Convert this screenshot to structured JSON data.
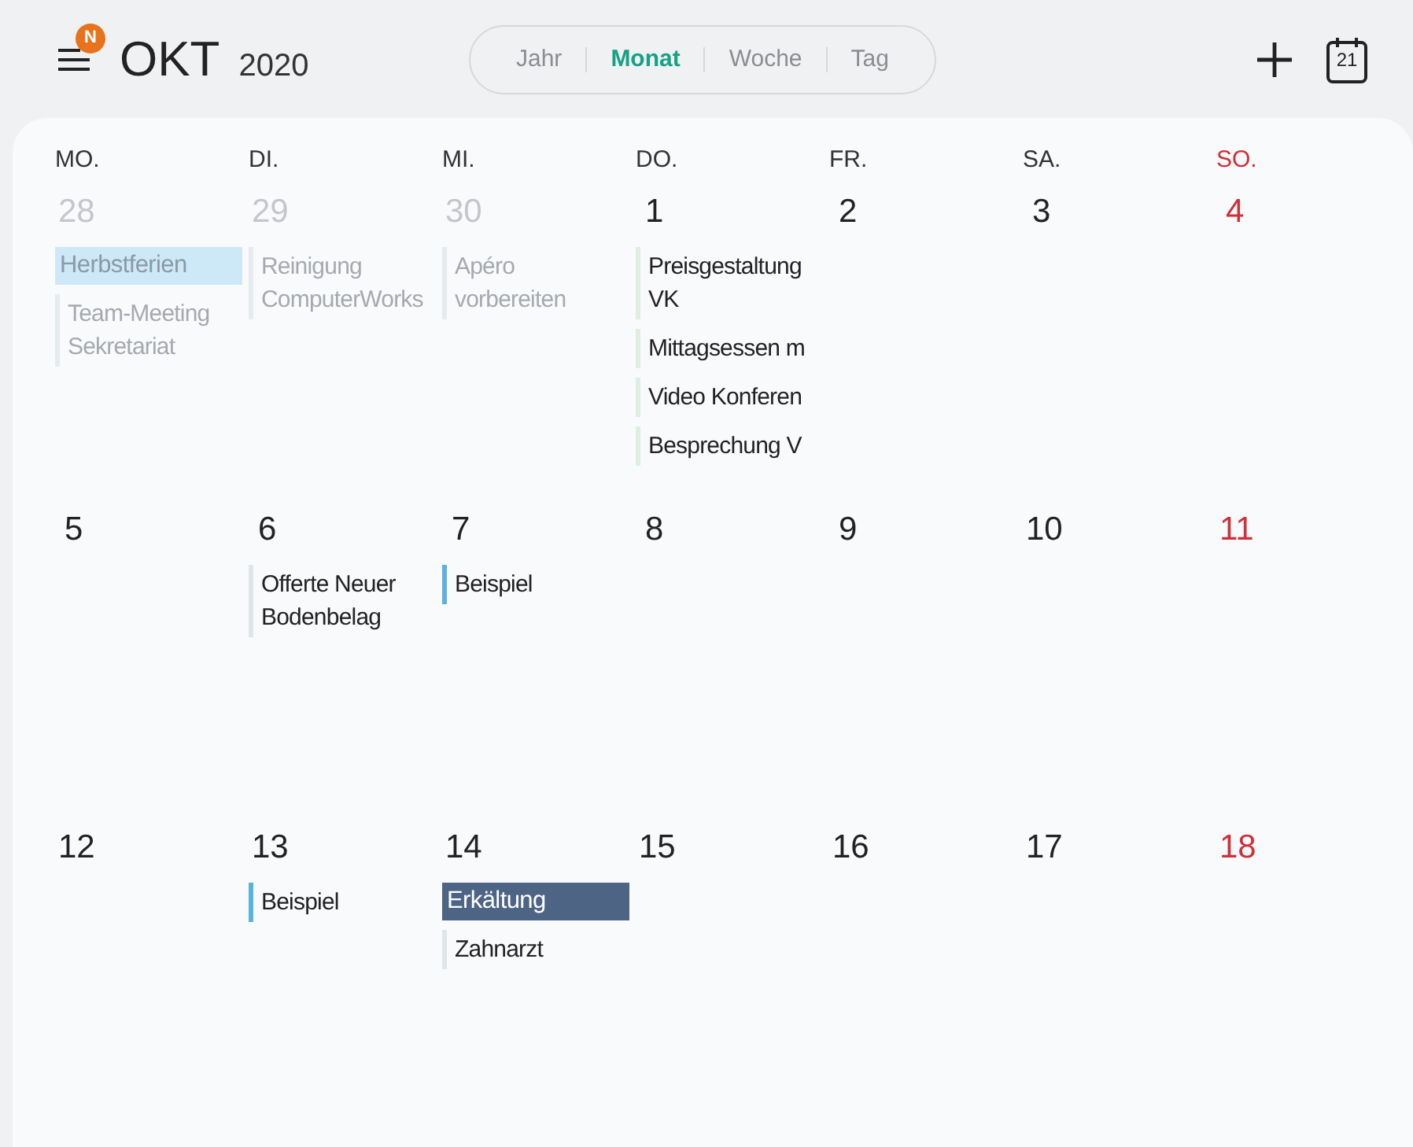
{
  "header": {
    "badge": "N",
    "month": "OKT",
    "year": "2020",
    "view_tabs": [
      {
        "label": "Jahr",
        "selected": false
      },
      {
        "label": "Monat",
        "selected": true
      },
      {
        "label": "Woche",
        "selected": false
      },
      {
        "label": "Tag",
        "selected": false
      }
    ],
    "today_icon": "21"
  },
  "weekdays": [
    {
      "label": "MO.",
      "kind": "weekday"
    },
    {
      "label": "DI.",
      "kind": "weekday"
    },
    {
      "label": "MI.",
      "kind": "weekday"
    },
    {
      "label": "DO.",
      "kind": "weekday"
    },
    {
      "label": "FR.",
      "kind": "weekday"
    },
    {
      "label": "SA.",
      "kind": "weekday"
    },
    {
      "label": "SO.",
      "kind": "sunday"
    }
  ],
  "weeks": [
    {
      "days": [
        {
          "date": "28",
          "other_month": true,
          "events": [
            {
              "kind": "allday",
              "title": "Herbstferien",
              "color": "#cde8f6"
            },
            {
              "kind": "timed",
              "title": "Team-Meeting Sekretariat",
              "color": "#e6ebee"
            }
          ]
        },
        {
          "date": "29",
          "other_month": true,
          "events": [
            {
              "kind": "timed",
              "title": "Reinigung ComputerWorks",
              "color": "#e6ebee"
            }
          ]
        },
        {
          "date": "30",
          "other_month": true,
          "events": [
            {
              "kind": "timed",
              "title": "Apéro vorbereiten",
              "color": "#e6ebee"
            }
          ]
        },
        {
          "date": "1",
          "other_month": false,
          "events": [
            {
              "kind": "timed",
              "title": "Preisgestaltung VK",
              "color": "#dcefe0"
            },
            {
              "kind": "timed",
              "title": "Mittagsessen m",
              "color": "#dcefe0"
            },
            {
              "kind": "timed",
              "title": "Video Konferen",
              "color": "#dcefe0"
            },
            {
              "kind": "timed",
              "title": "Besprechung V",
              "color": "#dcefe0"
            }
          ]
        },
        {
          "date": "2",
          "other_month": false
        },
        {
          "date": "3",
          "other_month": false
        },
        {
          "date": "4",
          "other_month": false
        }
      ]
    },
    {
      "days": [
        {
          "date": "5",
          "other_month": false
        },
        {
          "date": "6",
          "other_month": false,
          "events": [
            {
              "kind": "timed",
              "title": "Offerte Neuer Bodenbelag",
              "color": "#dfe6e8"
            }
          ]
        },
        {
          "date": "7",
          "other_month": false,
          "events": [
            {
              "kind": "timed",
              "title": "Beispiel",
              "color": "#5bb3d9"
            }
          ]
        },
        {
          "date": "8",
          "other_month": false
        },
        {
          "date": "9",
          "other_month": false
        },
        {
          "date": "10",
          "other_month": false
        },
        {
          "date": "11",
          "other_month": false
        }
      ]
    },
    {
      "days": [
        {
          "date": "12",
          "other_month": false
        },
        {
          "date": "13",
          "other_month": false,
          "events": [
            {
              "kind": "timed",
              "title": "Beispiel",
              "color": "#5bb3d9"
            }
          ]
        },
        {
          "date": "14",
          "other_month": false,
          "events": [
            {
              "kind": "allday",
              "title": "Erkältung",
              "color": "#4d6485"
            },
            {
              "kind": "timed",
              "title": "Zahnarzt",
              "color": "#dfe6e8"
            }
          ]
        },
        {
          "date": "15",
          "other_month": false
        },
        {
          "date": "16",
          "other_month": false
        },
        {
          "date": "17",
          "other_month": false
        },
        {
          "date": "18",
          "other_month": false
        }
      ]
    }
  ]
}
